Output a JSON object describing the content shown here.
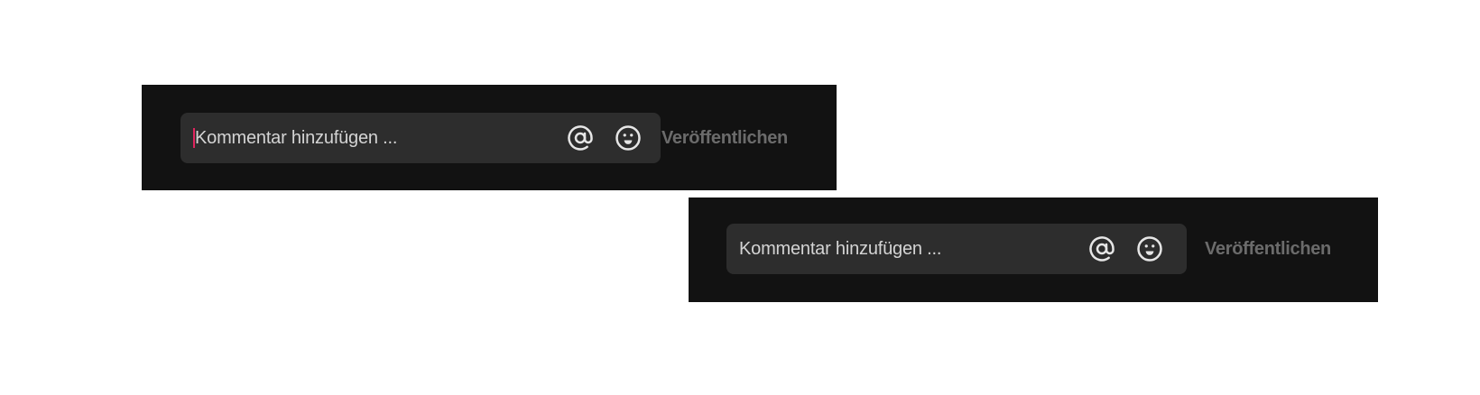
{
  "comment_boxes": [
    {
      "placeholder": "Kommentar hinzufügen ...",
      "focused": true,
      "mention_icon": "at-sign-icon",
      "emoji_icon": "smiley-face-icon",
      "publish_label": "Veröffentlichen"
    },
    {
      "placeholder": "Kommentar hinzufügen ...",
      "focused": false,
      "mention_icon": "at-sign-icon",
      "emoji_icon": "smiley-face-icon",
      "publish_label": "Veröffentlichen"
    }
  ],
  "colors": {
    "panel_bg": "#121212",
    "field_bg": "#2d2d2d",
    "placeholder_text": "#d4d4d4",
    "icon": "#e6e6e6",
    "publish_disabled": "#6b6b6b",
    "caret": "#e0245e"
  }
}
